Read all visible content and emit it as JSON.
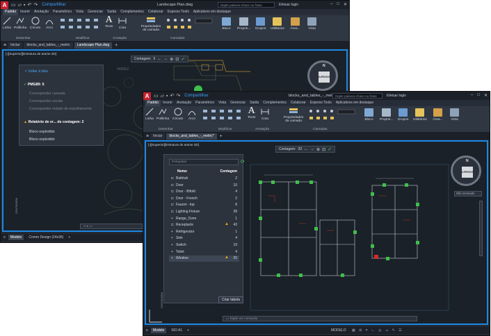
{
  "back_window": {
    "title": "Landscape Plan.dwg",
    "share_label": "Compartilhar",
    "ribbon_tabs": [
      "Padrão",
      "Inserir",
      "Anotação",
      "Paramétrico",
      "Vista",
      "Gerenciar",
      "Saída",
      "Complementos",
      "Colaborar",
      "Express Tools",
      "Aplicativos em destaque"
    ],
    "search_placeholder": "Digite palavra-chave ou frase",
    "login_label": "Efetuar login",
    "draw_tools": [
      "Linha",
      "Polilinha",
      "Círculo",
      "Arco"
    ],
    "annotation_tools": [
      "Texto",
      "Cota"
    ],
    "panel_labels": {
      "draw": "Desenhar",
      "modify": "Modificar",
      "annotation": "Anotação",
      "layers": "Camadas"
    },
    "layer_props_label": "Propriedades da camada",
    "right_panels": [
      "Bloco",
      "Proprie...",
      "Grupos",
      "Utilitários",
      "Área...",
      "Vista"
    ],
    "file_tabs": [
      "Iniciar",
      "blocks_and_tables_-_metric",
      "Landscape Plan.dwg"
    ],
    "active_file_tab": 2,
    "viewport_label": "[-][Superior][Estrutura de arame 2D]",
    "count_bar": {
      "label": "Contagem:",
      "value": "5"
    },
    "count_palette": {
      "back_link": "< Voltar à lista",
      "block_name": "PMG89: 5",
      "options": [
        "Corresponder camada",
        "Corresponder escala",
        "Corresponder estado de espelhamento"
      ],
      "report_title": "Relatório de er... de contagem: 2",
      "report_items": [
        "Bloco explodido",
        "Bloco explodido"
      ],
      "sidebar_label": "CONTAGEM"
    },
    "status_tabs": [
      "Modelo",
      "Comm Design (24x36)"
    ],
    "map_labels": [
      "0465E2",
      "1043"
    ]
  },
  "front_window": {
    "title": "blocks_and_tables_-_metric.dwg",
    "share_label": "Compartilhar",
    "ribbon_tabs": [
      "Padrão",
      "Inserir",
      "Anotação",
      "Paramétrico",
      "Vista",
      "Gerenciar",
      "Saída",
      "Complementos",
      "Colaborar",
      "Express Tools",
      "Aplicativos em destaque"
    ],
    "search_placeholder": "Digite palavra-chave ou frase",
    "login_label": "Efetuar login",
    "draw_tools": [
      "Linha",
      "Polilinha",
      "Círculo",
      "Arco"
    ],
    "annotation_tools": [
      "Texto",
      "Cota"
    ],
    "panel_labels": {
      "draw": "Desenhar",
      "modify": "Modificar",
      "annotation": "Anotação",
      "layers": "Camadas"
    },
    "layer_props_label": "Propriedades da camada",
    "right_panels": [
      "Bloco",
      "Proprie...",
      "Grupos",
      "Utilitários",
      "Área...",
      "Vista"
    ],
    "file_tabs": [
      "Iniciar",
      "blocks_and_tables_-_metric*"
    ],
    "active_file_tab": 1,
    "viewport_label": "[-][Superior][Estrutura de arame 2D]",
    "count_bar": {
      "label": "Contagem:",
      "value": "20"
    },
    "count_table": {
      "search_placeholder": "Pesquisar",
      "col_name": "Nome",
      "col_count": "Contagem",
      "rows": [
        {
          "name": "Bathtub",
          "count": "2",
          "warn": false,
          "expand": false
        },
        {
          "name": "Door",
          "count": "10",
          "warn": false,
          "expand": false
        },
        {
          "name": "Door - Bifold",
          "count": "4",
          "warn": false,
          "expand": false
        },
        {
          "name": "Door - French",
          "count": "2",
          "warn": false,
          "expand": false
        },
        {
          "name": "Faucet - top",
          "count": "8",
          "warn": false,
          "expand": false
        },
        {
          "name": "Lighting Fixture",
          "count": "28",
          "warn": false,
          "expand": false
        },
        {
          "name": "Range_Oven",
          "count": "1",
          "warn": false,
          "expand": true
        },
        {
          "name": "Receptacle",
          "count": "43",
          "warn": true,
          "expand": false
        },
        {
          "name": "Refrigerator",
          "count": "1",
          "warn": false,
          "expand": true
        },
        {
          "name": "Sink",
          "count": "4",
          "warn": false,
          "expand": true
        },
        {
          "name": "Switch",
          "count": "19",
          "warn": false,
          "expand": true
        },
        {
          "name": "Toilet",
          "count": "4",
          "warn": false,
          "expand": true
        },
        {
          "name": "Window",
          "count": "20",
          "warn": true,
          "expand": true
        }
      ],
      "selected_row": 12,
      "create_button": "Criar tabela",
      "sidebar_label": "CONTAGEM"
    },
    "navcube": {
      "face": "SUPERIOR",
      "north": "N",
      "label": "Não nomeado"
    },
    "command_placeholder": "Digite um comando",
    "status_tabs": [
      "Modelo",
      "ISO A1"
    ],
    "status_mode": "MODELO"
  },
  "colors": {
    "accent": "#1e88e5",
    "bg": "#222933",
    "ok": "#4fc35a",
    "warn": "#f4b400",
    "brand": "#c8202f"
  }
}
